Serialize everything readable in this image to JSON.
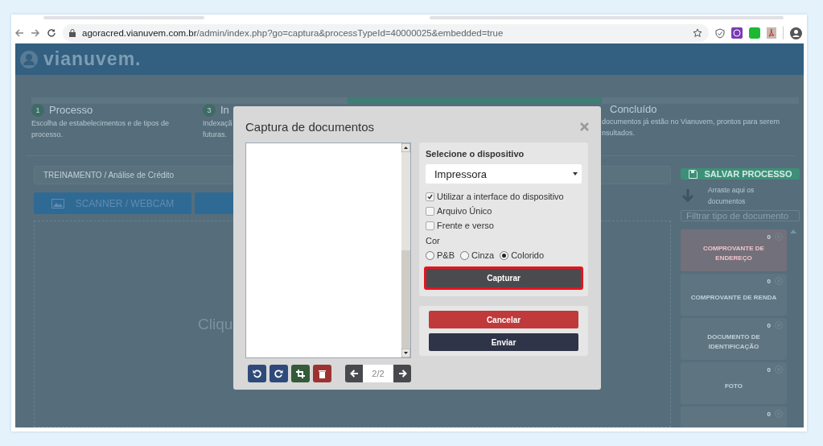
{
  "browser": {
    "url_domain": "agoracred.vianuvem.com.br",
    "url_path": "/admin/index.php?go=captura&processTypeId=40000025&embedded=true"
  },
  "app": {
    "logo": "vianuvem."
  },
  "steps": [
    {
      "number": "1",
      "title": "Processo",
      "lines": [
        "Escolha de estabelecimentos e de tipos de",
        "processo."
      ],
      "selected": false
    },
    {
      "number": "3",
      "title": "In",
      "lines": [
        "Indexaçã",
        "futuras."
      ],
      "selected": false
    },
    {
      "selected": true
    },
    {
      "title": "Concluído",
      "lines": [
        "documentos já estão no Vianuvem, prontos para serem",
        "nsultados."
      ],
      "selected": false
    }
  ],
  "breadcrumb": "TREINAMENTO / Análise de Crédito",
  "capture_buttons": [
    {
      "kind": "scanner",
      "label": "SCANNER / WEBCAM"
    },
    {
      "kind": "files"
    }
  ],
  "drop_area": {
    "text": "Cliqu"
  },
  "sidebar": {
    "save_button": "SALVAR PROCESSO",
    "drop_hint": "Arraste aqui os documentos",
    "filter": {
      "placeholder": "Filtrar tipo de documento"
    },
    "document_types": [
      {
        "label": "COMPROVANTE DE ENDEREÇO",
        "count": "0",
        "selected": true
      },
      {
        "label": "COMPROVANTE DE RENDA",
        "count": "0",
        "selected": false
      },
      {
        "label": "DOCUMENTO DE IDENTIFICAÇÃO",
        "count": "0",
        "selected": false
      },
      {
        "label": "FOTO",
        "count": "0",
        "selected": false
      },
      {
        "count": "0",
        "selected": false
      }
    ]
  },
  "dialog": {
    "title": "Captura de documentos",
    "pager": {
      "value": "2/2"
    },
    "device": {
      "label": "Selecione o dispositivo",
      "value": "Impressora"
    },
    "options": [
      {
        "label": "Utilizar a interface do dispositivo",
        "checked": true
      },
      {
        "label": "Arquivo Único",
        "checked": false
      },
      {
        "label": "Frente e verso",
        "checked": false
      }
    ],
    "color": {
      "label": "Cor",
      "choices": [
        {
          "label": "P&B",
          "selected": false
        },
        {
          "label": "Cinza",
          "selected": false
        },
        {
          "label": "Colorido",
          "selected": true
        }
      ]
    },
    "capture_button": {
      "label": "Capturar",
      "focused": true
    },
    "cancel_button": "Cancelar",
    "send_button": "Enviar"
  }
}
